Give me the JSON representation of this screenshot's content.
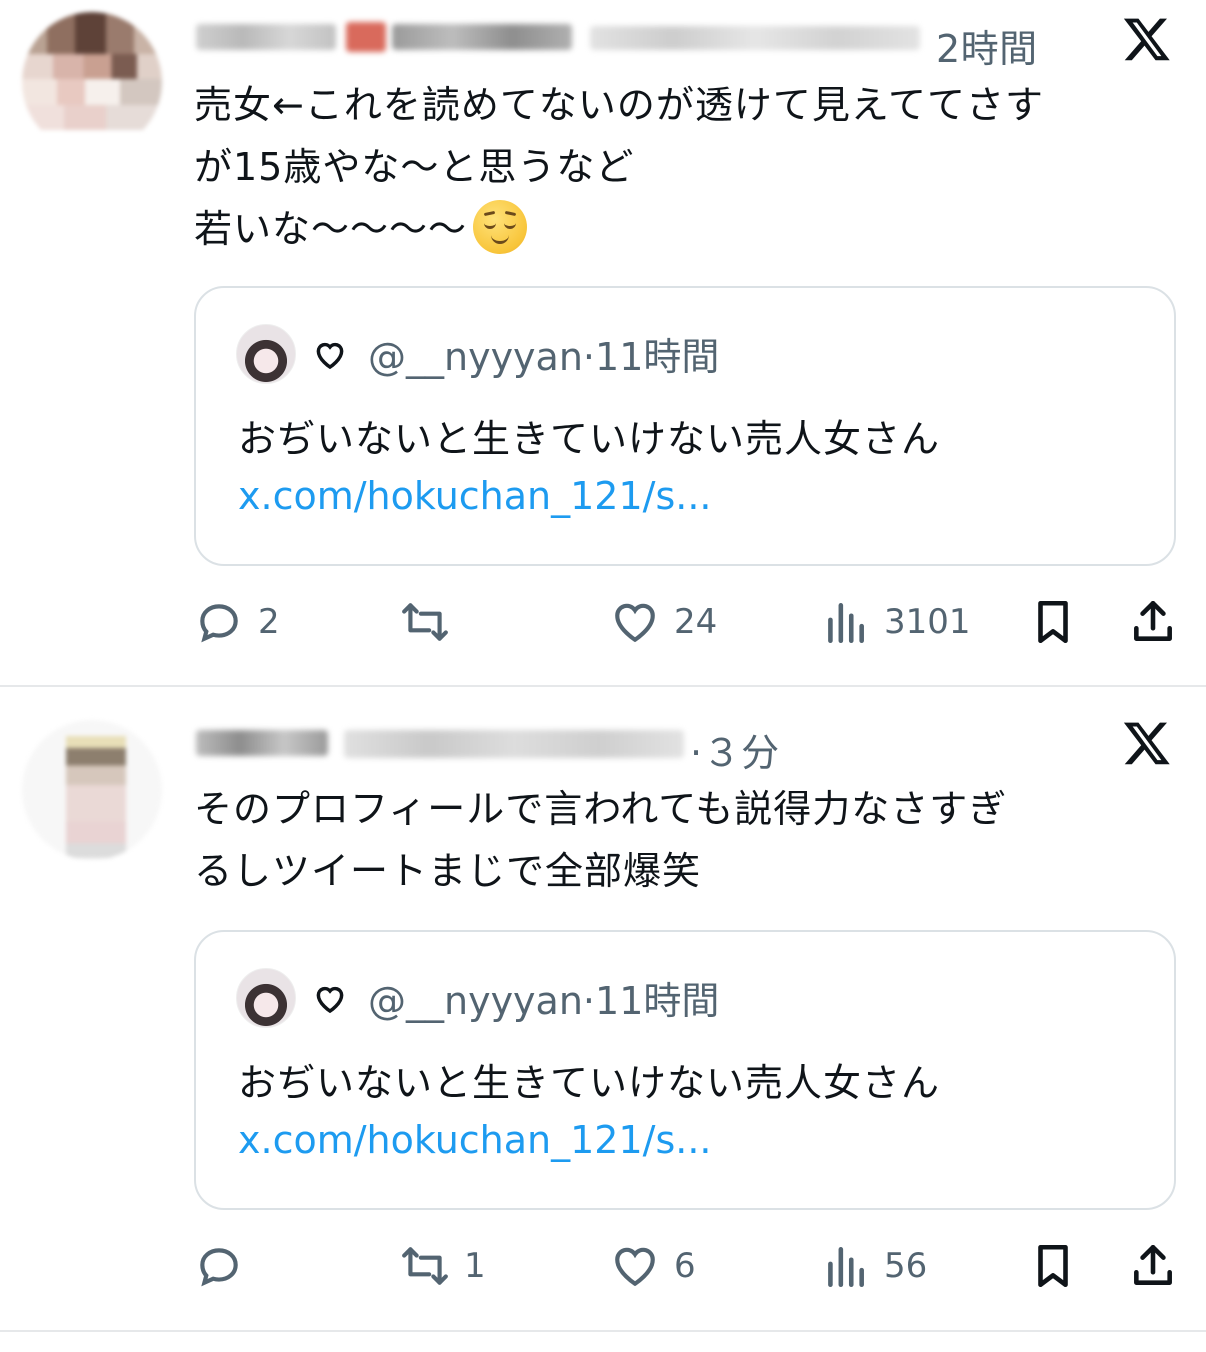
{
  "tweets": [
    {
      "time": "2時間",
      "text_lines": [
        "売女←これを読めてないのが透けて見えててさす",
        "が15歳やな〜と思うなど",
        "若いな〜〜〜〜"
      ],
      "emoji": "relieved-face",
      "quote": {
        "handle": "@__nyyyan",
        "dot": "·",
        "time": "11時間",
        "text": "おぢいないと生きていけない売人女さん",
        "link": "x.com/hokuchan_121/s..."
      },
      "actions": {
        "reply_count": "2",
        "retweet_count": "",
        "like_count": "24",
        "views_count": "3101"
      }
    },
    {
      "time": "·３分",
      "text_lines": [
        "そのプロフィールで言われても説得力なさすぎ",
        "るしツイートまじで全部爆笑"
      ],
      "quote": {
        "handle": "@__nyyyan",
        "dot": "·",
        "time": "11時間",
        "text": "おぢいないと生きていけない売人女さん",
        "link": "x.com/hokuchan_121/s..."
      },
      "actions": {
        "reply_count": "",
        "retweet_count": "1",
        "like_count": "6",
        "views_count": "56"
      }
    }
  ],
  "icons": [
    "x-logo-icon",
    "reply-icon",
    "retweet-icon",
    "like-icon",
    "views-icon",
    "bookmark-icon",
    "share-icon",
    "heart-outline-icon"
  ],
  "colors": {
    "text": "#0f1419",
    "muted": "#536471",
    "link": "#1d9bf0",
    "border": "#dbe1e5"
  }
}
